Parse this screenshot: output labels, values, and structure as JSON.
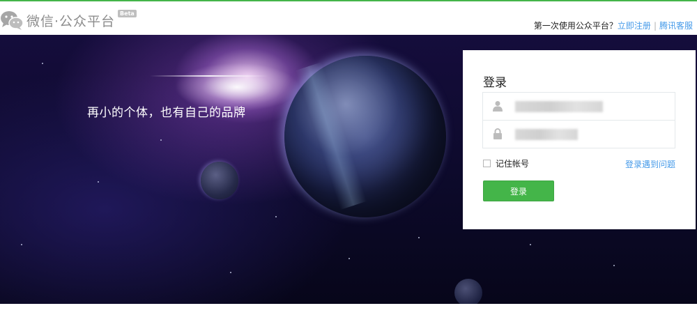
{
  "header": {
    "logo_text": "微信·公众平台",
    "beta_label": "Beta",
    "first_time_prompt": "第一次使用公众平台？",
    "register_link": "立即注册",
    "separator": "|",
    "support_link": "腾讯客服"
  },
  "banner": {
    "slogan": "再小的个体，也有自己的品牌"
  },
  "login": {
    "title": "登录",
    "username_value": "",
    "password_value": "",
    "remember_label": "记住帐号",
    "remember_checked": false,
    "problem_link": "登录遇到问题",
    "submit_label": "登录"
  },
  "colors": {
    "brand_green": "#44b549",
    "link_blue": "#459ae9"
  }
}
